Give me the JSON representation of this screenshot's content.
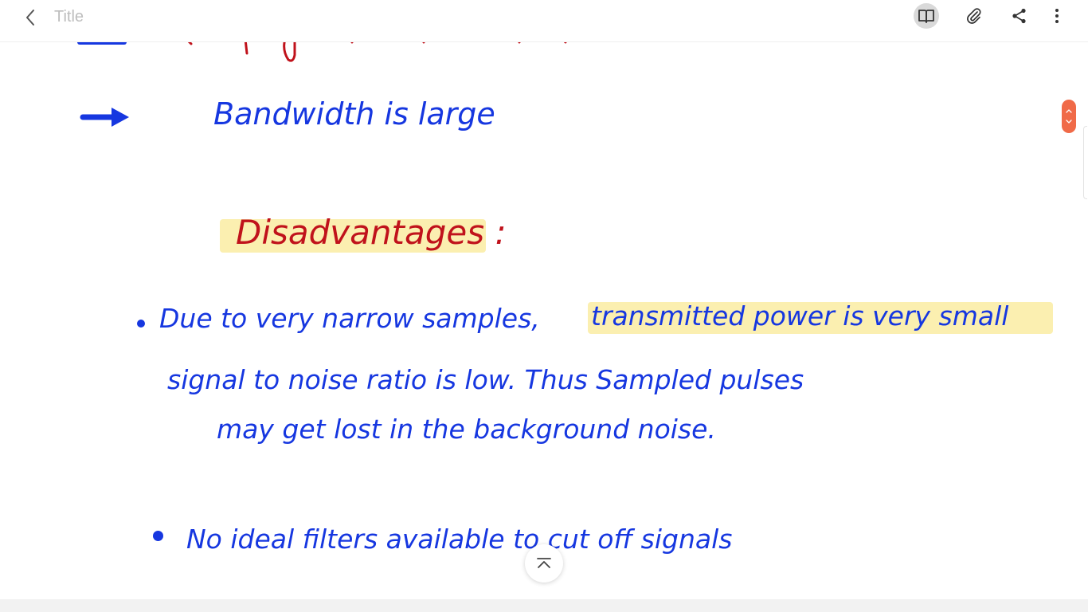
{
  "header": {
    "title": "Title"
  },
  "note": {
    "partial_top_line": "→ …",
    "line_bandwidth": "Bandwidth   is   large",
    "heading_disadvantages": "Disadvantages :",
    "bullet1_part1": "Due  to  very  narrow  samples,",
    "bullet1_highlighted": "transmitted  power  is very small",
    "bullet1_line2": "signal  to  noise  ratio  is  low. Thus  Sampled  pulses",
    "bullet1_line3": "may  get  lost  in  the  background  noise.",
    "bullet2": "No  ideal  filters  available  to cut off  signals"
  },
  "colors": {
    "ink_blue": "#1637e0",
    "ink_red": "#c0121b",
    "highlight_yellow": "#fbefb0",
    "scroll_thumb": "#f06a48"
  },
  "icons": {
    "back": "chevron-left-icon",
    "reader_mode": "open-book-icon",
    "attach": "paperclip-icon",
    "share": "share-icon",
    "more": "more-vertical-icon",
    "scroll_to_top": "scroll-to-top-icon"
  }
}
